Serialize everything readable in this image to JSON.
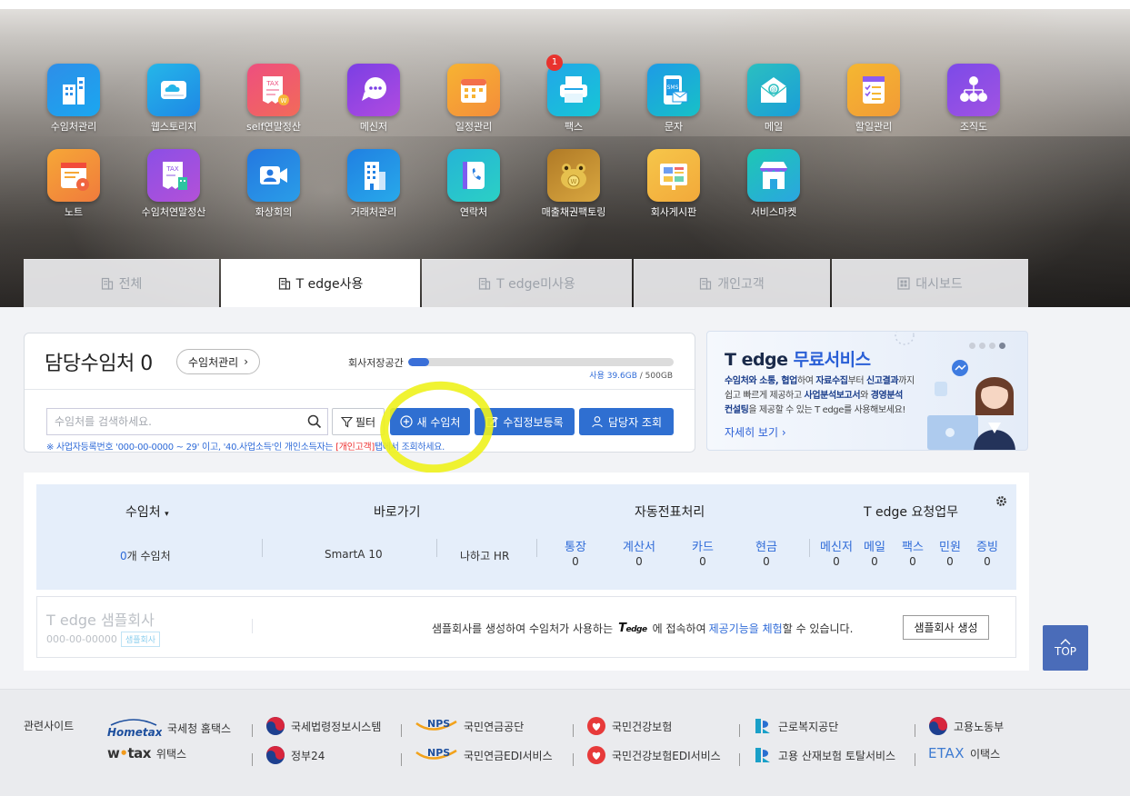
{
  "apps_row1": [
    {
      "label": "수임처관리",
      "icon": "building-icon",
      "color": "#2e8ee8",
      "color2": "#1aa7f0"
    },
    {
      "label": "웹스토리지",
      "icon": "cloud-storage-icon",
      "color": "#25b6e9",
      "color2": "#1e88e5"
    },
    {
      "label": "self연말정산",
      "icon": "tax-receipt-icon",
      "color": "#ee4f7f",
      "color2": "#f26a59"
    },
    {
      "label": "메신저",
      "icon": "chat-bubble-icon",
      "color": "#7b3fe4",
      "color2": "#b04be0"
    },
    {
      "label": "일정관리",
      "icon": "calendar-icon",
      "color": "#f7b332",
      "color2": "#f48d3a"
    },
    {
      "label": "팩스",
      "icon": "fax-icon",
      "color": "#22a7e8",
      "color2": "#16c6d6"
    },
    {
      "label": "문자",
      "icon": "sms-icon",
      "color": "#1e9be6",
      "color2": "#17c1c7"
    },
    {
      "label": "메일",
      "icon": "mail-icon",
      "color": "#2bbfc0",
      "color2": "#1a9ed8"
    },
    {
      "label": "할일관리",
      "icon": "checklist-icon",
      "color": "#f5b731",
      "color2": "#f29b36"
    },
    {
      "label": "조직도",
      "icon": "org-chart-icon",
      "color": "#7c4ae8",
      "color2": "#a153e2"
    }
  ],
  "apps_row2": [
    {
      "label": "노트",
      "icon": "note-icon",
      "color": "#f6a737",
      "color2": "#f07b3c"
    },
    {
      "label": "수임처연말정산",
      "icon": "tax-building-icon",
      "color": "#8b4fe6",
      "color2": "#b351d8"
    },
    {
      "label": "화상회의",
      "icon": "video-call-icon",
      "color": "#2478e0",
      "color2": "#2a9de8"
    },
    {
      "label": "거래처관리",
      "icon": "office-building-icon",
      "color": "#2080e2",
      "color2": "#28a9ea"
    },
    {
      "label": "연락처",
      "icon": "phone-book-icon",
      "color": "#25b4d6",
      "color2": "#2bd0c5"
    },
    {
      "label": "매출채권팩토링",
      "icon": "money-frog-icon",
      "color": "#b07a26",
      "color2": "#d9a740"
    },
    {
      "label": "회사게시판",
      "icon": "bulletin-board-icon",
      "color": "#f6c64a",
      "color2": "#f2a93a"
    },
    {
      "label": "서비스마켓",
      "icon": "market-store-icon",
      "color": "#1ec7b4",
      "color2": "#2aa6e0"
    }
  ],
  "fax_badge": "1",
  "tabs": [
    {
      "label": "전체",
      "active": false
    },
    {
      "label": "T edge사용",
      "active": true
    },
    {
      "label": "T edge미사용",
      "active": false
    },
    {
      "label": "개인고객",
      "active": false
    },
    {
      "label": "대시보드",
      "active": false
    }
  ],
  "card": {
    "title": "담당수임처 0",
    "manage_btn": "수임처관리",
    "storage_label": "회사저장공간",
    "storage_fraction": 0.08,
    "storage_used": "사용 39.6GB",
    "storage_total": " / 500GB",
    "search_placeholder": "수임처를 검색하세요.",
    "filter_btn": "필터",
    "new_client_btn": "새 수임처",
    "collect_btn": "수집정보등록",
    "manager_btn": "담당자 조회",
    "note_pre": "※ 사업자등록번호 '000-00-0000 ~ 29' 이고, '40.사업소득'인 개인소득자는 ",
    "note_red": "[개인고객]",
    "note_post": "탭에서 조회하세요."
  },
  "promo": {
    "title_a": "T edge ",
    "title_b": "무료서비스",
    "line1_b1": "수임처와 소통, 협업",
    "line1_t1": "하여 ",
    "line1_b2": "자료수집",
    "line1_t2": "부터 ",
    "line1_b3": "신고결과",
    "line1_t3": "까지",
    "line2_t1": "쉽고 빠르게 제공하고 ",
    "line2_b1": "사업분석보고서",
    "line2_t2": "와 ",
    "line2_b2": "경영분석",
    "line3_b1": "컨설팅",
    "line3_t1": "을 제공할 수 있는 T edge를 사용해보세요!",
    "more": "자세히 보기 ›"
  },
  "stats": {
    "h_client": "수임처",
    "h_shortcut": "바로가기",
    "h_auto": "자동전표처리",
    "h_request": "T edge 요청업무",
    "client_count": "0",
    "client_suffix": "개 수임처",
    "smarta": "SmartA 10",
    "nahago": "나하고 HR",
    "auto": [
      {
        "label": "통장",
        "value": "0"
      },
      {
        "label": "계산서",
        "value": "0"
      },
      {
        "label": "카드",
        "value": "0"
      },
      {
        "label": "현금",
        "value": "0"
      }
    ],
    "req": [
      {
        "label": "메신저",
        "value": "0"
      },
      {
        "label": "메일",
        "value": "0"
      },
      {
        "label": "팩스",
        "value": "0"
      },
      {
        "label": "민원",
        "value": "0"
      },
      {
        "label": "증빙",
        "value": "0"
      }
    ]
  },
  "sample": {
    "name": "T edge 샘플회사",
    "id": "000-00-00000",
    "tag": "샘플회사",
    "msg_a": "샘플회사를 생성하여 수임처가 사용하는",
    "brand": "T edge",
    "msg_b": "에 접속하여",
    "msg_blue": "제공기능을 체험",
    "msg_c": "할 수 있습니다.",
    "btn": "샘플회사 생성"
  },
  "top_btn": "TOP",
  "footer": {
    "title": "관련사이트",
    "row1": [
      {
        "logo": "Hometax",
        "label": "국세청 홈택스"
      },
      {
        "logo": "",
        "label": "국세법령정보시스템"
      },
      {
        "logo": "NPS",
        "label": "국민연금공단"
      },
      {
        "logo": "",
        "label": "국민건강보험"
      },
      {
        "logo": "",
        "label": "근로복지공단"
      },
      {
        "logo": "",
        "label": "고용노동부"
      }
    ],
    "row2": [
      {
        "logo": "wetax",
        "label": "위택스"
      },
      {
        "logo": "",
        "label": "정부24"
      },
      {
        "logo": "NPS",
        "label": "국민연금EDI서비스"
      },
      {
        "logo": "",
        "label": "국민건강보험EDI서비스"
      },
      {
        "logo": "",
        "label": "고용 산재보험 토탈서비스"
      },
      {
        "logo": "ETAX",
        "label": "이택스"
      }
    ]
  }
}
